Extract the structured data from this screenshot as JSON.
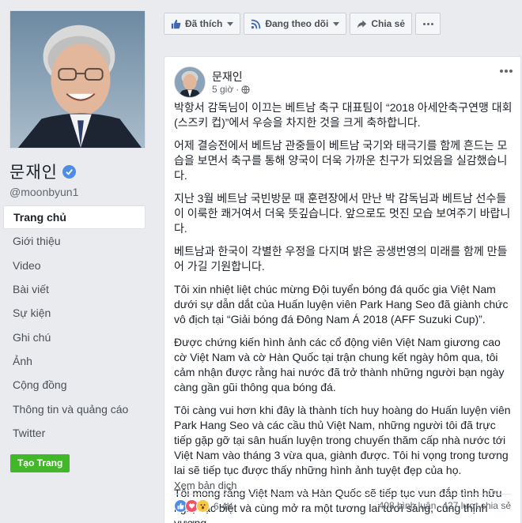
{
  "profile": {
    "name": "문재인",
    "username": "@moonbyun1"
  },
  "nav": {
    "items": [
      {
        "label": "Trang chủ",
        "active": true
      },
      {
        "label": "Giới thiệu"
      },
      {
        "label": "Video"
      },
      {
        "label": "Bài viết"
      },
      {
        "label": "Sự kiện"
      },
      {
        "label": "Ghi chú"
      },
      {
        "label": "Ảnh"
      },
      {
        "label": "Cộng đồng"
      },
      {
        "label": "Thông tin và quảng cáo"
      },
      {
        "label": "Twitter"
      }
    ],
    "create_page_label": "Tạo Trang"
  },
  "action_bar": {
    "like_label": "Đã thích",
    "follow_label": "Đang theo dõi",
    "share_label": "Chia sẻ"
  },
  "post": {
    "author": "문재인",
    "time": "5 giờ",
    "paragraphs": [
      "박항서 감독님이 이끄는 베트남 축구 대표팀이 “2018 아세안축구연맹 대회(스즈키 컵)”에서 우승을 차지한 것을 크게 축하합니다.",
      "어제 결승전에서 베트남 관중들이 베트남 국기와 태극기를 함께 흔드는 모습을 보면서 축구를 통해 양국이 더욱 가까운 친구가 되었음을 실감했습니다.",
      "지난 3월 베트남 국빈방문 때 훈련장에서 만난 박 감독님과 베트남 선수들이 이룩한 쾌거여서 더욱 뜻깊습니다. 앞으로도 멋진 모습 보여주기 바랍니다.",
      "베트남과 한국이 각별한 우정을 다지며 밝은 공생번영의 미래를 함께 만들어 가길 기원합니다.",
      "Tôi xin nhiệt liệt chúc mừng Đội tuyển bóng đá quốc gia Việt Nam dưới sự dẫn dắt của Huấn luyện viên Park Hang Seo đã giành chức vô địch tại “Giải bóng đá Đông Nam Á 2018 (AFF Suzuki Cup)”.",
      "Được chứng kiến hình ảnh các cổ động viên Việt Nam giương cao cờ Việt Nam và cờ Hàn Quốc tại trận chung kết ngày hôm qua, tôi cảm nhận được rằng hai nước đã trở thành những người bạn ngày càng gần gũi thông qua bóng đá.",
      "Tôi càng vui hơn khi đây là thành tích huy hoàng do Huấn luyện viên Park Hang Seo và các cầu thủ Việt Nam, những người tôi đã trực tiếp gặp gỡ tại sân huấn luyện trong chuyến thăm cấp nhà nước tới Việt Nam vào tháng 3 vừa qua, giành được. Tôi hi vọng trong tương lai sẽ tiếp tục được thấy những hình ảnh tuyệt đẹp của họ.",
      "Tôi mong rằng Việt Nam và Hàn Quốc sẽ tiếp tục vun đắp tình hữu nghị đặc biệt và cùng mở ra một tương lai tươi sáng, cùng thịnh vượng."
    ],
    "see_translation": "Xem bản dịch",
    "reaction_count": "6,4K",
    "comments": "408 bình luận",
    "shares": "427 lượt chia sẻ"
  },
  "colors": {
    "brand_blue": "#4267b2",
    "link_blue": "#4c8de6",
    "create_green": "#42b72a",
    "page_bg": "#e9ebee"
  },
  "icons": {
    "verified": "verified-check-icon",
    "like": "thumbs-up-icon",
    "follow": "rss-icon",
    "share": "share-arrow-icon",
    "more": "more-dots-icon",
    "privacy": "globe-icon"
  }
}
